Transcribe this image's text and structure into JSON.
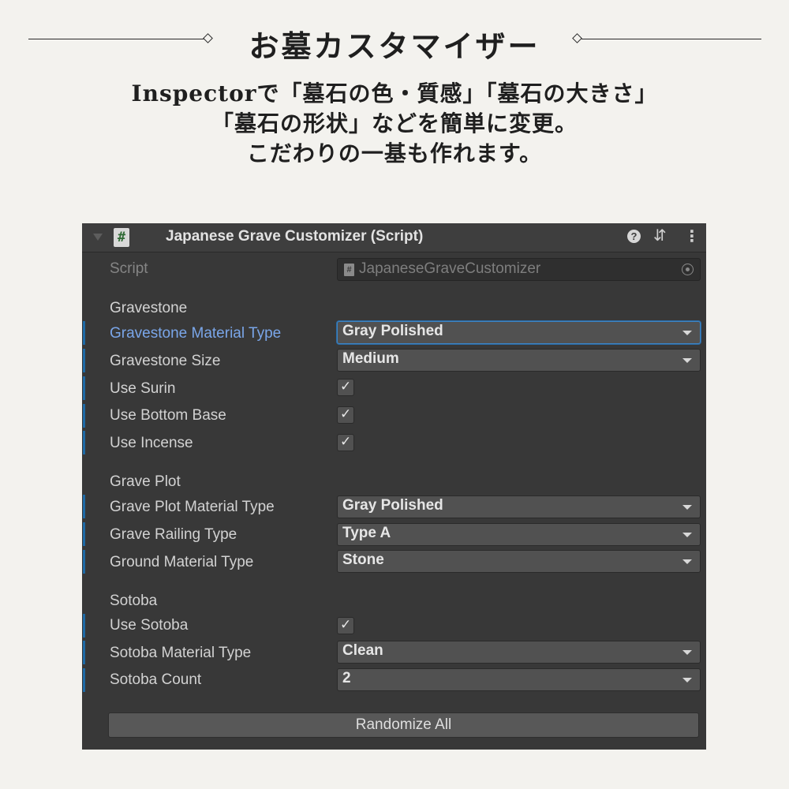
{
  "promo": {
    "title": "お墓カスタマイザー",
    "subtitle_lines": [
      "Inspectorで「墓石の色・質感」「墓石の大きさ」",
      "「墓石の形状」などを簡単に変更。",
      "こだわりの一基も作れます。"
    ]
  },
  "inspector": {
    "component_title": "Japanese Grave Customizer (Script)",
    "script_icon_glyph": "#",
    "script_field": {
      "label": "Script",
      "value": "JapaneseGraveCustomizer"
    },
    "sections": {
      "gravestone": "Gravestone",
      "grave_plot": "Grave Plot",
      "sotoba": "Sotoba"
    },
    "fields": {
      "gravestone_material_type": {
        "label": "Gravestone Material Type",
        "value": "Gray Polished"
      },
      "gravestone_size": {
        "label": "Gravestone Size",
        "value": "Medium"
      },
      "use_surin": {
        "label": "Use Surin",
        "checked": true
      },
      "use_bottom_base": {
        "label": "Use Bottom Base",
        "checked": true
      },
      "use_incense": {
        "label": "Use Incense",
        "checked": true
      },
      "grave_plot_material_type": {
        "label": "Grave Plot Material Type",
        "value": "Gray Polished"
      },
      "grave_railing_type": {
        "label": "Grave Railing Type",
        "value": "Type A"
      },
      "ground_material_type": {
        "label": "Ground Material Type",
        "value": "Stone"
      },
      "use_sotoba": {
        "label": "Use Sotoba",
        "checked": true
      },
      "sotoba_material_type": {
        "label": "Sotoba Material Type",
        "value": "Clean"
      },
      "sotoba_count": {
        "label": "Sotoba Count",
        "value": "2"
      }
    },
    "randomize_label": "Randomize All",
    "check_glyph": "✓",
    "icons": [
      "foldout-arrow-icon",
      "script-icon",
      "help-icon",
      "presets-icon",
      "kebab-menu-icon",
      "file-icon",
      "object-picker-icon",
      "dropdown-arrow-icon"
    ],
    "colors": {
      "panel_bg": "#383838",
      "header_bg": "#3e3e3e",
      "field_bg": "#515151",
      "override_bar": "#1e6aa6",
      "active_label": "#7aa6e9"
    }
  }
}
